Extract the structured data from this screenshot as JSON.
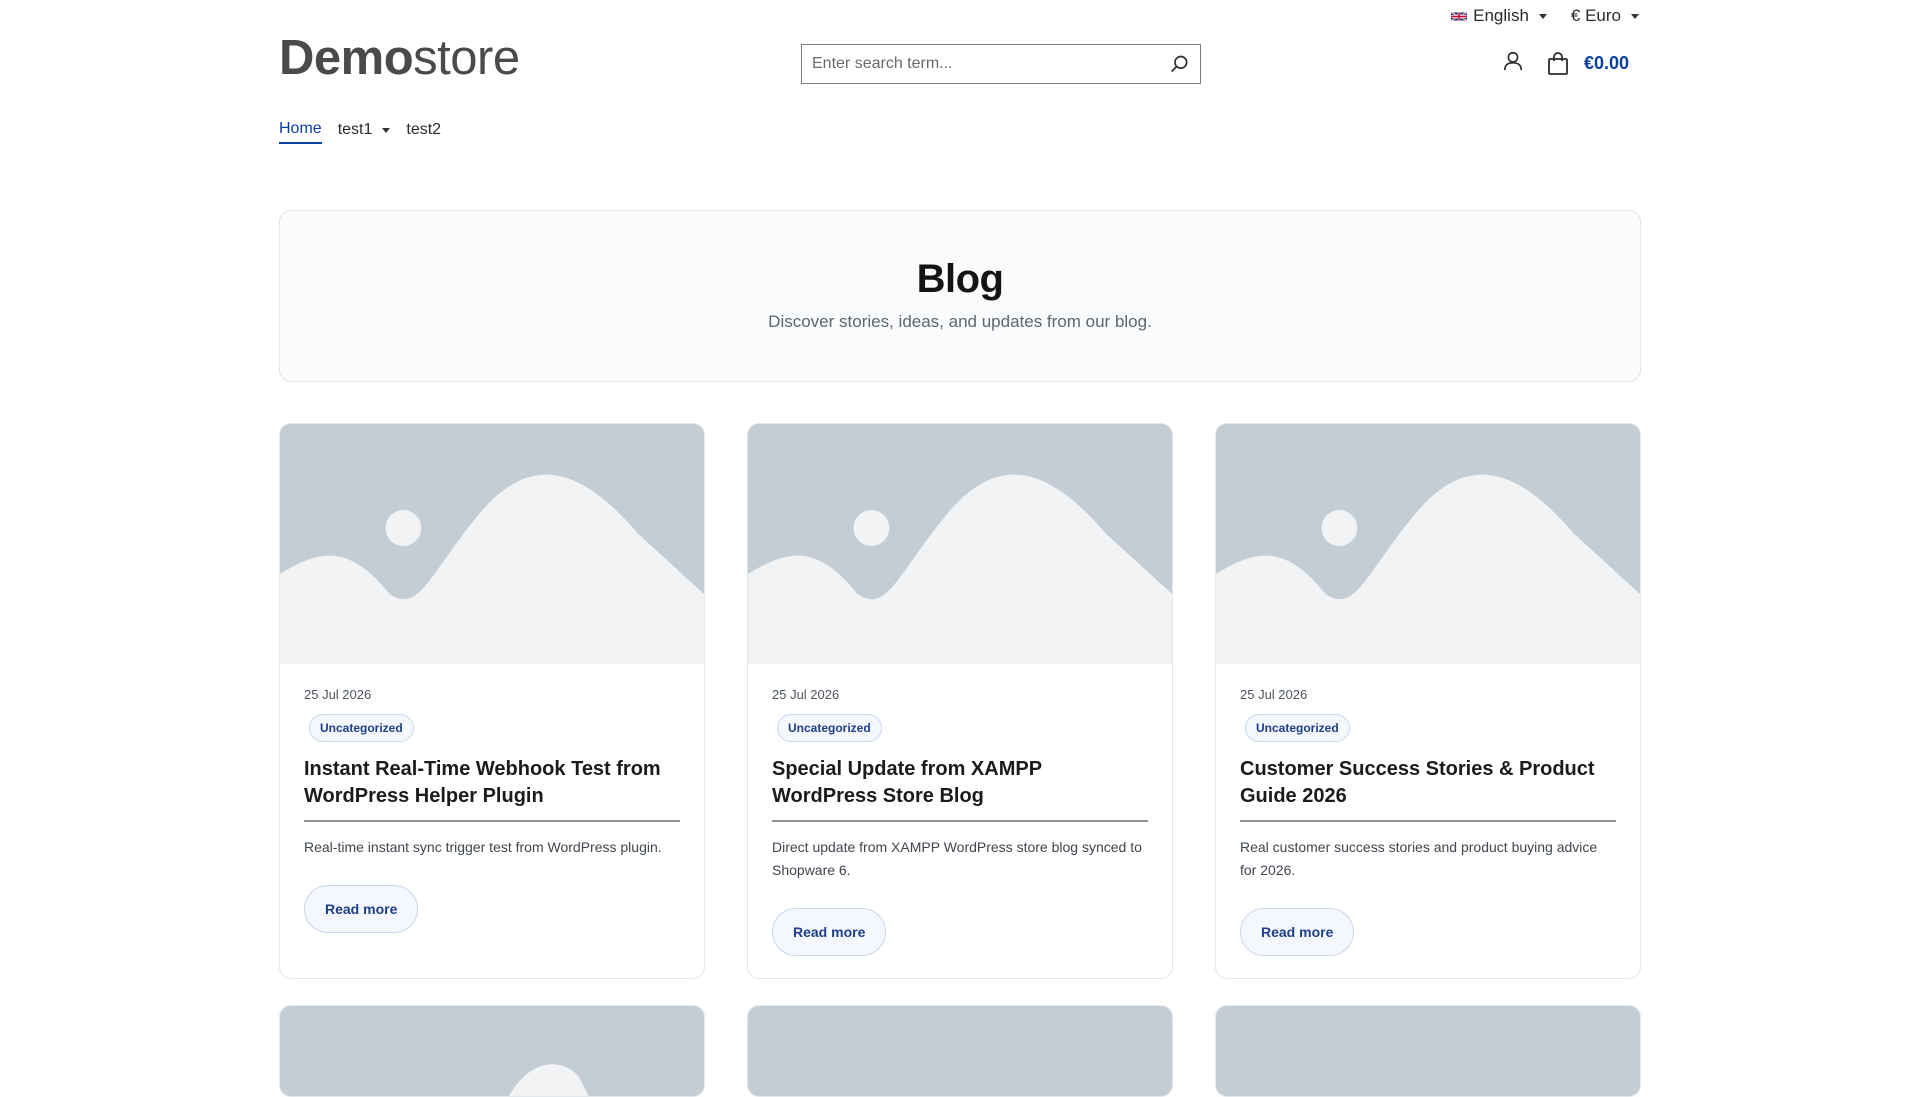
{
  "topbar": {
    "language": "English",
    "currency": "€ Euro"
  },
  "header": {
    "logo_bold": "Demo",
    "logo_light": "store",
    "search_placeholder": "Enter search term...",
    "cart_total": "€0.00"
  },
  "nav": {
    "items": [
      "Home",
      "test1",
      "test2"
    ]
  },
  "hero": {
    "title": "Blog",
    "subtitle": "Discover stories, ideas, and updates from our blog."
  },
  "posts": [
    {
      "date": "25 Jul 2026",
      "category": "Uncategorized",
      "title": "Instant Real-Time Webhook Test from WordPress Helper Plugin",
      "excerpt": "Real-time instant sync trigger test from WordPress plugin.",
      "cta": "Read more"
    },
    {
      "date": "25 Jul 2026",
      "category": "Uncategorized",
      "title": "Special Update from XAMPP WordPress Store Blog",
      "excerpt": "Direct update from XAMPP WordPress store blog synced to Shopware 6.",
      "cta": "Read more"
    },
    {
      "date": "25 Jul 2026",
      "category": "Uncategorized",
      "title": "Customer Success Stories & Product Guide 2026",
      "excerpt": "Real customer success stories and product buying advice for 2026.",
      "cta": "Read more"
    }
  ],
  "colors": {
    "accent": "#0b3fa0",
    "placeholder_bg": "#c4ccd4",
    "placeholder_shape": "#f2f3f5"
  }
}
